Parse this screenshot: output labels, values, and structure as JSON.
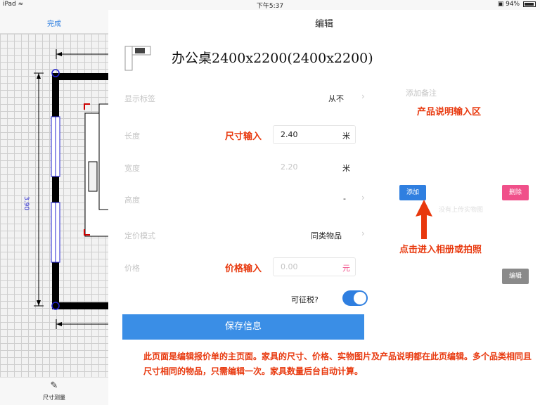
{
  "status_bar": {
    "device": "iPad",
    "time": "下午5:37",
    "battery": "94%"
  },
  "left_panel": {
    "done_label": "完成",
    "dimension_label": "3.90",
    "tool_label": "尺寸测量"
  },
  "main": {
    "title": "编辑",
    "product_name": "办公桌2400x2200(2400x2200)",
    "rows": {
      "display_label": {
        "label": "显示标签",
        "value": "从不"
      },
      "length": {
        "label": "长度",
        "value": "2.40",
        "unit": "米"
      },
      "width": {
        "label": "宽度",
        "value": "2.20",
        "unit": "米"
      },
      "height": {
        "label": "高度",
        "value": "-"
      },
      "pricing_mode": {
        "label": "定价模式",
        "value": "同类物品"
      },
      "price": {
        "label": "价格",
        "placeholder": "0.00",
        "unit": "元"
      },
      "taxable": {
        "label": "可征税?",
        "on": true
      }
    },
    "save_label": "保存信息",
    "notes_placeholder": "添加备注",
    "photo_hint": "没有上传实物图",
    "buttons": {
      "add": "添加",
      "delete": "删除",
      "edit": "编辑"
    }
  },
  "annotations": {
    "size_input": "尺寸输入",
    "price_input": "价格输入",
    "description_area": "产品说明输入区",
    "click_photo": "点击进入相册或拍照",
    "bottom_note": "此页面是编辑报价单的主页面。家具的尺寸、价格、实物图片及产品说明都在此页编辑。多个品类相同且尺寸相同的物品，只需编辑一次。家具数量后台自动计算。"
  },
  "colors": {
    "accent": "#2f7fe0",
    "annotation": "#e8380d",
    "delete": "#f0508a",
    "edit": "#8a8a8a"
  }
}
